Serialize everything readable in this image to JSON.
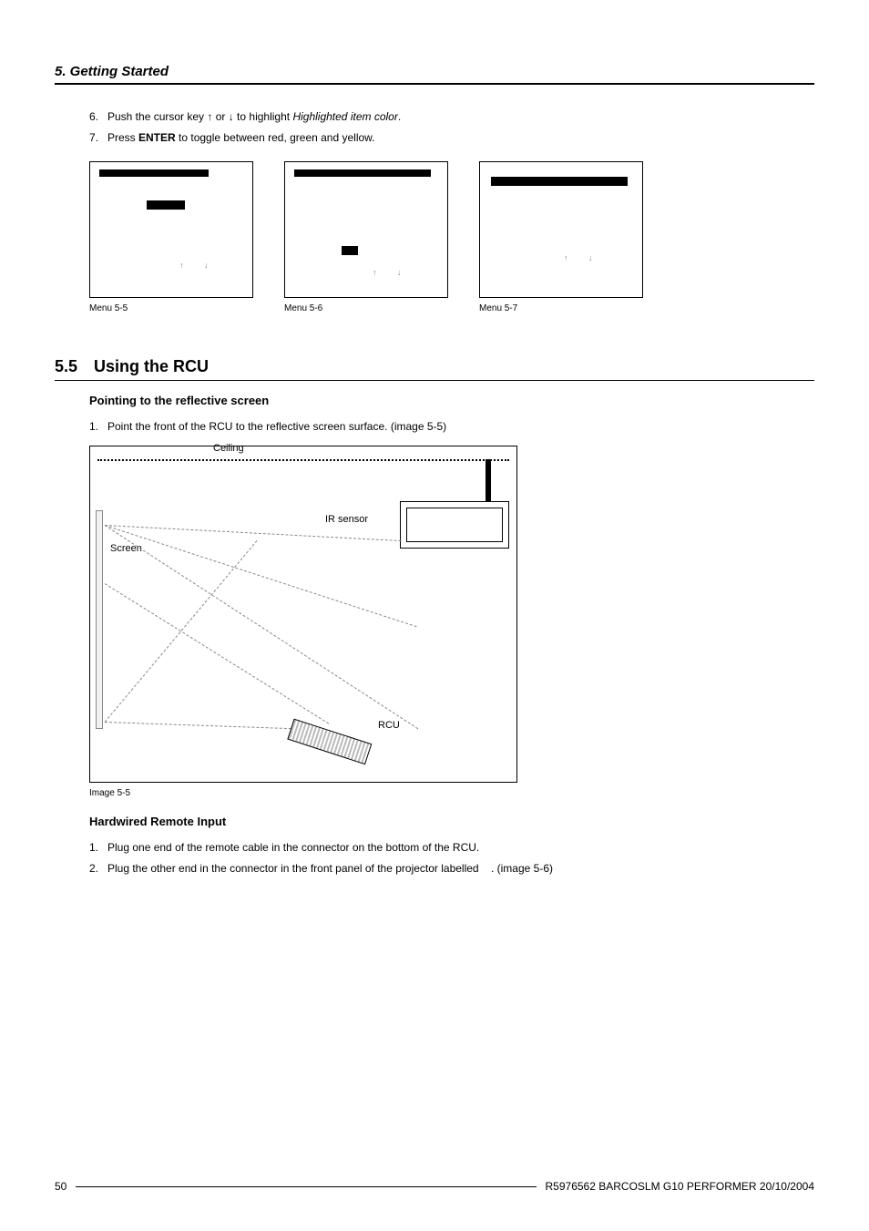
{
  "chapter": {
    "label": "5. Getting Started"
  },
  "steps_top": [
    {
      "num": "6.",
      "pre": "Push the cursor key ↑ or ↓ to highlight ",
      "italic": "Highlighted item color",
      "post": "."
    },
    {
      "num": "7.",
      "pre": "Press ",
      "bold": "ENTER",
      "post": " to toggle between red, green and yellow."
    }
  ],
  "menus": {
    "arrow_glyphs": "↑  ↓",
    "m1": {
      "caption": "Menu 5-5"
    },
    "m2": {
      "caption": "Menu 5-6"
    },
    "m3": {
      "caption": "Menu 5-7"
    }
  },
  "section": {
    "num": "5.5",
    "title": "Using the RCU"
  },
  "sub1": {
    "title": "Pointing to the reflective screen",
    "steps": [
      {
        "num": "1.",
        "text": "Point the front of the RCU to the reflective screen surface. (image 5-5)"
      }
    ]
  },
  "figure": {
    "labels": {
      "ceiling": "Ceiling",
      "ir": "IR sensor",
      "screen": "Screen",
      "rcu": "RCU"
    },
    "caption": "Image 5-5"
  },
  "sub2": {
    "title": "Hardwired Remote Input",
    "steps": [
      {
        "num": "1.",
        "text": "Plug one end of the remote cable in the connector on the bottom of the RCU."
      },
      {
        "num": "2.",
        "text_pre": "Plug the other end in the connector in the front panel of the projector labelled ",
        "text_post": ". (image 5-6)"
      }
    ]
  },
  "footer": {
    "page": "50",
    "doc": "R5976562  BARCOSLM G10 PERFORMER  20/10/2004"
  }
}
